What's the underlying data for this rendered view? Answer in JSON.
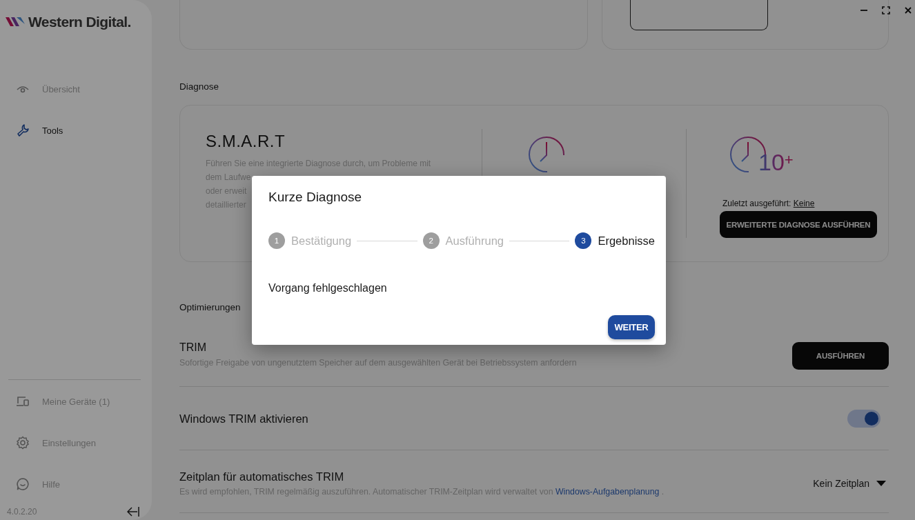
{
  "sidebar": {
    "logo": "Western Digital.",
    "nav": [
      {
        "kind": "overview",
        "label": "Übersicht",
        "selected": false
      },
      {
        "kind": "tools",
        "label": "Tools",
        "selected": true
      }
    ],
    "bottom_nav": [
      {
        "kind": "devices",
        "label": "Meine Geräte (1)",
        "selected": false
      },
      {
        "kind": "settings",
        "label": "Einstellungen",
        "selected": false
      },
      {
        "kind": "help",
        "label": "Hilfe",
        "selected": false
      }
    ],
    "version": "4.0.2.20"
  },
  "main": {
    "diagnose": {
      "heading": "Diagnose",
      "smart": {
        "title": "S.M.A.R.T",
        "description_lines": [
          "Führen Sie eine integrierte Diagnose durch, um Probleme mit",
          "dem Laufwe",
          "oder erweit",
          "detaillierter"
        ]
      },
      "short_test": {
        "kind": "clock"
      },
      "extended_test": {
        "duration": "10$^{+}$",
        "last_run_label": "Zuletzt ausgeführt:",
        "last_run_value": "Keine",
        "button": "ERWEITERTE DIAGNOSE AUSFÜHREN"
      }
    },
    "optimizations": {
      "heading": "Optimierungen",
      "rows": [
        {
          "kind": "action",
          "title": "TRIM",
          "description": "Sofortige Freigabe von ungenutztem Speicher auf dem ausgewählten Gerät bei Betriebssystem anfordern",
          "button": "AUSFÜHREN"
        },
        {
          "kind": "toggle",
          "title": "Windows TRIM aktivieren",
          "on": true
        },
        {
          "kind": "schedule",
          "title": "Zeitplan für automatisches TRIM",
          "description": "Es wird empfohlen, TRIM regelmäßig auszuführen. Automatischer TRIM-Zeitplan wird verwaltet von",
          "link": "Windows-Aufgabenplanung",
          "description_end": ".",
          "value": "Kein Zeitplan"
        }
      ]
    }
  },
  "dialog": {
    "title": "Kurze Diagnose",
    "steps": [
      {
        "number": "1",
        "label": "Bestätigung",
        "selected": false
      },
      {
        "number": "2",
        "label": "Ausführung",
        "selected": false
      },
      {
        "number": "3",
        "label": "Ergebnisse",
        "selected": true
      }
    ],
    "message": "Vorgang fehlgeschlagen",
    "button": "WEITER"
  }
}
